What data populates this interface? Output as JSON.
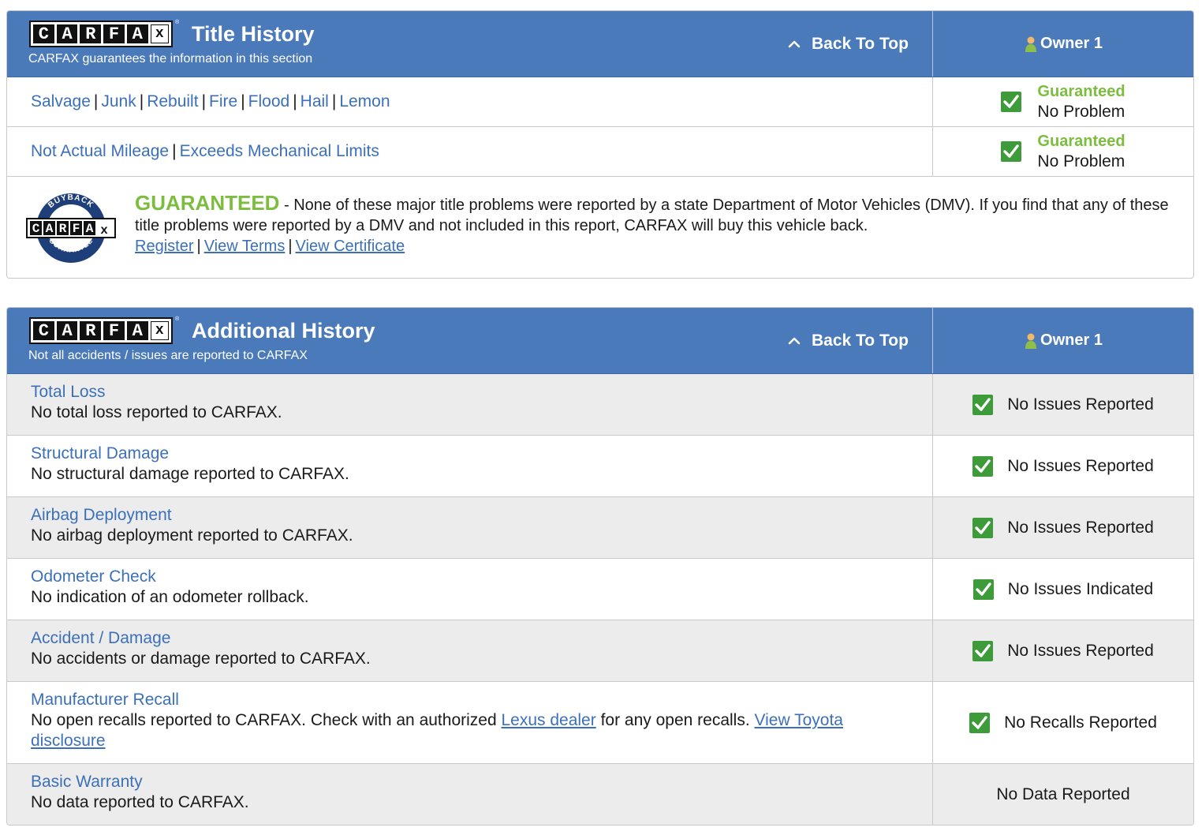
{
  "title_history": {
    "logo_text": "CARFAX",
    "title": "Title History",
    "subtitle": "CARFAX guarantees the information in this section",
    "back_to_top": "Back To Top",
    "owner": "Owner 1",
    "rows": [
      {
        "links": [
          "Salvage",
          "Junk",
          "Rebuilt",
          "Fire",
          "Flood",
          "Hail",
          "Lemon"
        ],
        "status_label": "Guaranteed",
        "status_value": "No Problem"
      },
      {
        "links": [
          "Not Actual Mileage",
          "Exceeds Mechanical Limits"
        ],
        "status_label": "Guaranteed",
        "status_value": "No Problem"
      }
    ],
    "buyback": {
      "badge_top": "BUYBACK",
      "badge_middle": "CARFAX",
      "badge_bottom": "GUARANTEE",
      "headline": "GUARANTEED",
      "text": " - None of these major title problems were reported by a state Department of Motor Vehicles (DMV). If you find that any of these title problems were reported by a DMV and not included in this report, CARFAX will buy this vehicle back.",
      "links": [
        "Register",
        "View Terms",
        "View Certificate"
      ]
    }
  },
  "additional_history": {
    "logo_text": "CARFAX",
    "title": "Additional History",
    "subtitle": "Not all accidents / issues are reported to CARFAX",
    "back_to_top": "Back To Top",
    "owner": "Owner 1",
    "rows": [
      {
        "title": "Total Loss",
        "desc": "No total loss reported to CARFAX.",
        "status": "No Issues Reported",
        "check": true
      },
      {
        "title": "Structural Damage",
        "desc": "No structural damage reported to CARFAX.",
        "status": "No Issues Reported",
        "check": true
      },
      {
        "title": "Airbag Deployment",
        "desc": "No airbag deployment reported to CARFAX.",
        "status": "No Issues Reported",
        "check": true
      },
      {
        "title": "Odometer Check",
        "desc": "No indication of an odometer rollback.",
        "status": "No Issues Indicated",
        "check": true
      },
      {
        "title": "Accident / Damage",
        "desc": "No accidents or damage reported to CARFAX.",
        "status": "No Issues Reported",
        "check": true
      },
      {
        "title": "Manufacturer Recall",
        "desc_before": "No open recalls reported to CARFAX. Check with an authorized ",
        "desc_link1": "Lexus dealer",
        "desc_middle": " for any open recalls. ",
        "desc_link2": "View Toyota disclosure",
        "status": "No Recalls Reported",
        "check": true
      },
      {
        "title": "Basic Warranty",
        "desc": "No data reported to CARFAX.",
        "status": "No Data Reported",
        "check": false
      }
    ]
  },
  "colors": {
    "header_blue": "#4a7ab9",
    "link_blue": "#3c70b8",
    "guarantee_green": "#7cbd3f",
    "check_green": "#3e9b3a",
    "row_gray": "#ececec"
  },
  "icons": [
    "carfax-logo",
    "chevron-up-icon",
    "owner-person-icon",
    "green-check-icon",
    "buyback-guarantee-badge"
  ]
}
